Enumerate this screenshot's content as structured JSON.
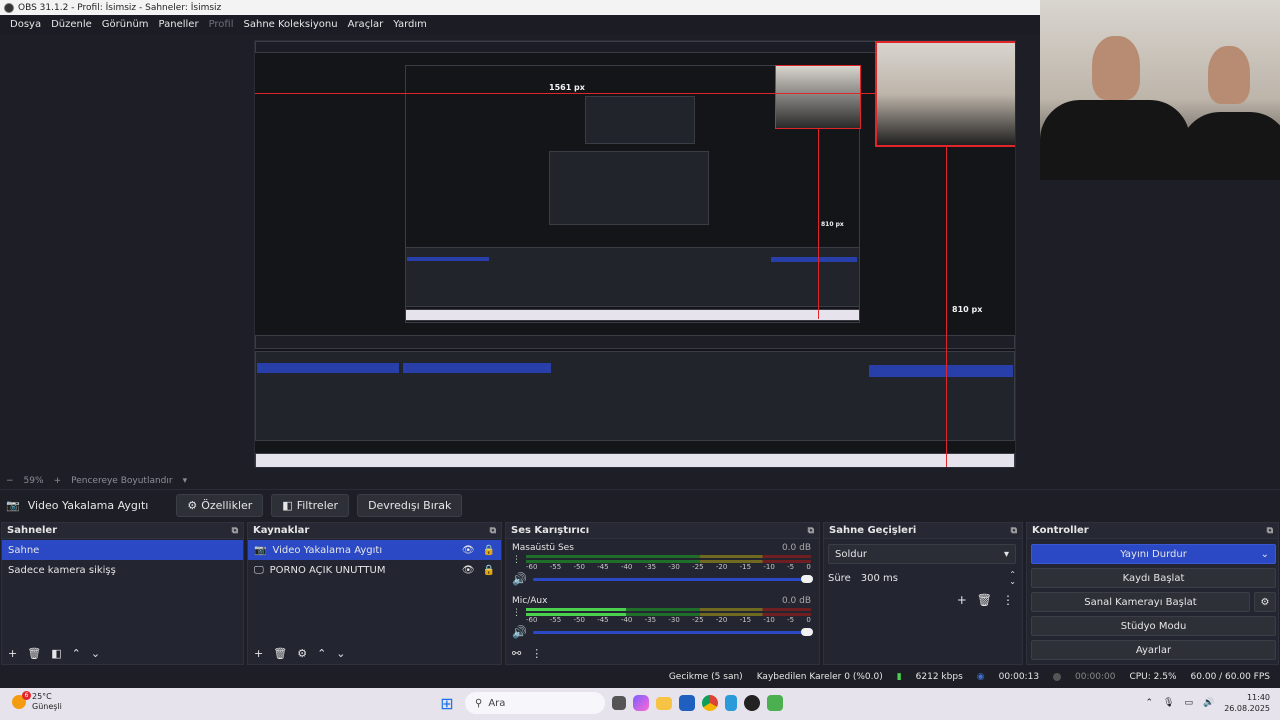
{
  "window": {
    "title": "OBS 31.1.2 - Profil: İsimsiz - Sahneler: İsimsiz"
  },
  "menu": [
    {
      "label": "Dosya",
      "disabled": false
    },
    {
      "label": "Düzenle",
      "disabled": false
    },
    {
      "label": "Görünüm",
      "disabled": false
    },
    {
      "label": "Paneller",
      "disabled": false
    },
    {
      "label": "Profil",
      "disabled": true
    },
    {
      "label": "Sahne Koleksiyonu",
      "disabled": false
    },
    {
      "label": "Araçlar",
      "disabled": false
    },
    {
      "label": "Yardım",
      "disabled": false
    }
  ],
  "preview": {
    "measure_top": "1561 px",
    "measure_right": "810 px",
    "measure_inner": "810 px"
  },
  "zoom": {
    "level": "59%",
    "fit_label": "Pencereye Boyutlandır"
  },
  "source_toolbar": {
    "selected_source": "Video Yakalama Aygıtı",
    "properties": "Özellikler",
    "filters": "Filtreler",
    "deactivate": "Devredışı Bırak"
  },
  "scenes": {
    "title": "Sahneler",
    "items": [
      "Sahne",
      "Sadece kamera sikişş"
    ],
    "selected_index": 0
  },
  "sources": {
    "title": "Kaynaklar",
    "items": [
      {
        "label": "Video Yakalama Aygıtı",
        "icon": "camera-icon"
      },
      {
        "label": "PORNO AÇIK UNUTTUM",
        "icon": "monitor-icon"
      }
    ]
  },
  "mixer": {
    "title": "Ses Karıştırıcı",
    "ticks": [
      "-60",
      "-55",
      "-50",
      "-45",
      "-40",
      "-35",
      "-30",
      "-25",
      "-20",
      "-15",
      "-10",
      "-5",
      "0"
    ],
    "tracks": [
      {
        "name": "Masaüstü Ses",
        "db": "0.0 dB",
        "level": 0
      },
      {
        "name": "Mic/Aux",
        "db": "0.0 dB",
        "level": 0.35
      }
    ]
  },
  "transitions": {
    "title": "Sahne Geçişleri",
    "selected": "Soldur",
    "duration_label": "Süre",
    "duration_value": "300 ms"
  },
  "controls": {
    "title": "Kontroller",
    "stream": "Yayını Durdur",
    "record": "Kaydı Başlat",
    "virtual_cam": "Sanal Kamerayı Başlat",
    "studio": "Stüdyo Modu",
    "settings": "Ayarlar"
  },
  "status": {
    "delay": "Gecikme (5 san)",
    "dropped": "Kaybedilen Kareler 0 (%0.0)",
    "bitrate": "6212 kbps",
    "stream_time": "00:00:13",
    "record_time": "00:00:00",
    "cpu": "CPU: 2.5%",
    "fps": "60.00 / 60.00 FPS"
  },
  "taskbar": {
    "weather_temp": "25°C",
    "weather_desc": "Güneşli",
    "weather_badge": "6",
    "search_placeholder": "Ara",
    "time": "11:40",
    "date": "26.08.2025"
  },
  "colors": {
    "accent": "#2b49c4",
    "measure_red": "#e0262a",
    "dock_bg": "#232530"
  }
}
